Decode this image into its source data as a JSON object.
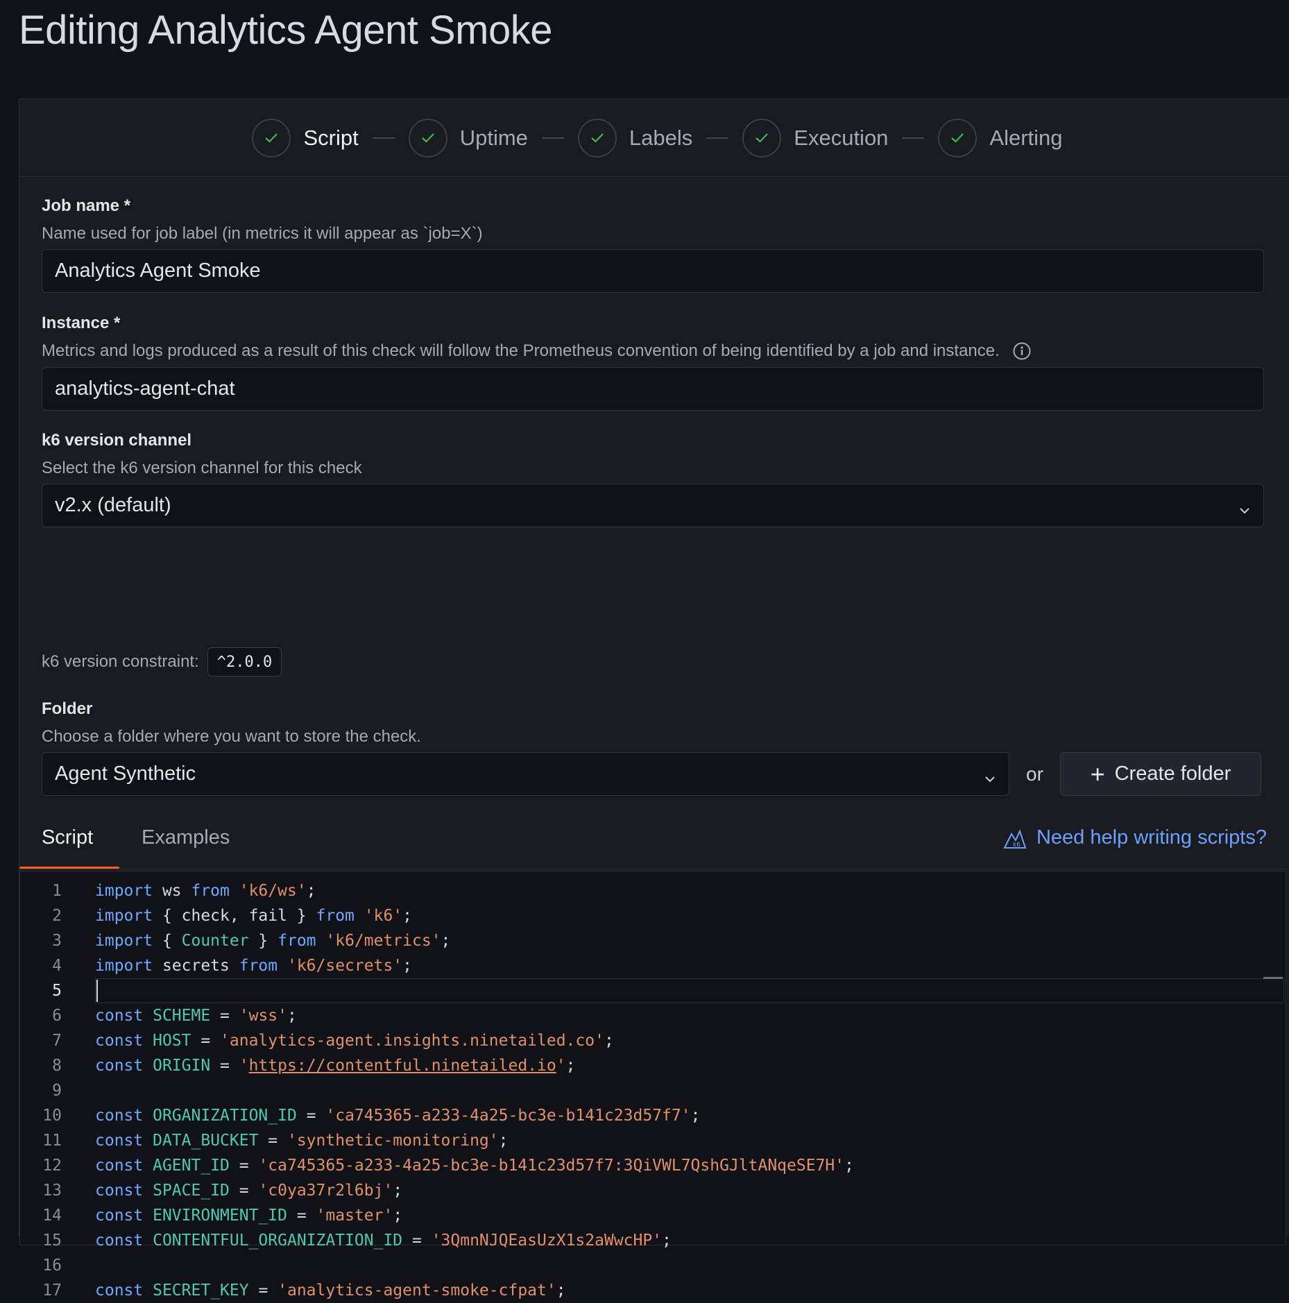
{
  "page": {
    "title": "Editing Analytics Agent Smoke"
  },
  "stepper": {
    "steps": [
      {
        "label": "Script",
        "state": "complete",
        "active": true
      },
      {
        "label": "Uptime",
        "state": "complete"
      },
      {
        "label": "Labels",
        "state": "complete"
      },
      {
        "label": "Execution",
        "state": "complete"
      },
      {
        "label": "Alerting",
        "state": "complete"
      }
    ]
  },
  "job_name": {
    "label": "Job name *",
    "description": "Name used for job label (in metrics it will appear as `job=X`)",
    "value": "Analytics Agent Smoke"
  },
  "instance": {
    "label": "Instance *",
    "description": "Metrics and logs produced as a result of this check will follow the Prometheus convention of being identified by a job and instance.",
    "value": "analytics-agent-chat"
  },
  "k6_channel": {
    "label": "k6 version channel",
    "description": "Select the k6 version channel for this check",
    "value": "v2.x (default)"
  },
  "k6_constraint": {
    "label": "k6 version constraint:",
    "value": "^2.0.0"
  },
  "folder": {
    "label": "Folder",
    "description": "Choose a folder where you want to store the check.",
    "value": "Agent Synthetic",
    "or_text": "or",
    "create_label": "Create folder"
  },
  "tabs": {
    "items": [
      {
        "label": "Script",
        "active": true
      },
      {
        "label": "Examples",
        "active": false
      }
    ],
    "help_link": "Need help writing scripts?"
  },
  "editor": {
    "current_line": 5,
    "lines": [
      {
        "n": "1",
        "tokens": [
          [
            "kw",
            "import"
          ],
          [
            "p",
            " ws "
          ],
          [
            "kw",
            "from"
          ],
          [
            "p",
            " "
          ],
          [
            "str",
            "'k6/ws'"
          ],
          [
            "p",
            ";"
          ]
        ]
      },
      {
        "n": "2",
        "tokens": [
          [
            "kw",
            "import"
          ],
          [
            "p",
            " { check, fail } "
          ],
          [
            "kw",
            "from"
          ],
          [
            "p",
            " "
          ],
          [
            "str",
            "'k6'"
          ],
          [
            "p",
            ";"
          ]
        ]
      },
      {
        "n": "3",
        "tokens": [
          [
            "kw",
            "import"
          ],
          [
            "p",
            " { "
          ],
          [
            "cst",
            "Counter"
          ],
          [
            "p",
            " } "
          ],
          [
            "kw",
            "from"
          ],
          [
            "p",
            " "
          ],
          [
            "str",
            "'k6/metrics'"
          ],
          [
            "p",
            ";"
          ]
        ]
      },
      {
        "n": "4",
        "tokens": [
          [
            "kw",
            "import"
          ],
          [
            "p",
            " secrets "
          ],
          [
            "kw",
            "from"
          ],
          [
            "p",
            " "
          ],
          [
            "str",
            "'k6/secrets'"
          ],
          [
            "p",
            ";"
          ]
        ]
      },
      {
        "n": "5",
        "tokens": []
      },
      {
        "n": "6",
        "tokens": [
          [
            "kw",
            "const"
          ],
          [
            "p",
            " "
          ],
          [
            "cst",
            "SCHEME"
          ],
          [
            "p",
            " = "
          ],
          [
            "str",
            "'wss'"
          ],
          [
            "p",
            ";"
          ]
        ]
      },
      {
        "n": "7",
        "tokens": [
          [
            "kw",
            "const"
          ],
          [
            "p",
            " "
          ],
          [
            "cst",
            "HOST"
          ],
          [
            "p",
            " = "
          ],
          [
            "str",
            "'analytics-agent.insights.ninetailed.co'"
          ],
          [
            "p",
            ";"
          ]
        ]
      },
      {
        "n": "8",
        "tokens": [
          [
            "kw",
            "const"
          ],
          [
            "p",
            " "
          ],
          [
            "cst",
            "ORIGIN"
          ],
          [
            "p",
            " = "
          ],
          [
            "str",
            "'"
          ],
          [
            "url",
            "https://contentful.ninetailed.io"
          ],
          [
            "str",
            "'"
          ],
          [
            "p",
            ";"
          ]
        ]
      },
      {
        "n": "9",
        "tokens": []
      },
      {
        "n": "10",
        "tokens": [
          [
            "kw",
            "const"
          ],
          [
            "p",
            " "
          ],
          [
            "cst",
            "ORGANIZATION_ID"
          ],
          [
            "p",
            " = "
          ],
          [
            "str",
            "'ca745365-a233-4a25-bc3e-b141c23d57f7'"
          ],
          [
            "p",
            ";"
          ]
        ]
      },
      {
        "n": "11",
        "tokens": [
          [
            "kw",
            "const"
          ],
          [
            "p",
            " "
          ],
          [
            "cst",
            "DATA_BUCKET"
          ],
          [
            "p",
            " = "
          ],
          [
            "str",
            "'synthetic-monitoring'"
          ],
          [
            "p",
            ";"
          ]
        ]
      },
      {
        "n": "12",
        "tokens": [
          [
            "kw",
            "const"
          ],
          [
            "p",
            " "
          ],
          [
            "cst",
            "AGENT_ID"
          ],
          [
            "p",
            " = "
          ],
          [
            "str",
            "'ca745365-a233-4a25-bc3e-b141c23d57f7:3QiVWL7QshGJltANqeSE7H'"
          ],
          [
            "p",
            ";"
          ]
        ]
      },
      {
        "n": "13",
        "tokens": [
          [
            "kw",
            "const"
          ],
          [
            "p",
            " "
          ],
          [
            "cst",
            "SPACE_ID"
          ],
          [
            "p",
            " = "
          ],
          [
            "str",
            "'c0ya37r2l6bj'"
          ],
          [
            "p",
            ";"
          ]
        ]
      },
      {
        "n": "14",
        "tokens": [
          [
            "kw",
            "const"
          ],
          [
            "p",
            " "
          ],
          [
            "cst",
            "ENVIRONMENT_ID"
          ],
          [
            "p",
            " = "
          ],
          [
            "str",
            "'master'"
          ],
          [
            "p",
            ";"
          ]
        ]
      },
      {
        "n": "15",
        "tokens": [
          [
            "kw",
            "const"
          ],
          [
            "p",
            " "
          ],
          [
            "cst",
            "CONTENTFUL_ORGANIZATION_ID"
          ],
          [
            "p",
            " = "
          ],
          [
            "str",
            "'3QmnNJQEasUzX1s2aWwcHP'"
          ],
          [
            "p",
            ";"
          ]
        ]
      },
      {
        "n": "16",
        "tokens": []
      },
      {
        "n": "17",
        "tokens": [
          [
            "kw",
            "const"
          ],
          [
            "p",
            " "
          ],
          [
            "cst",
            "SECRET_KEY"
          ],
          [
            "p",
            " = "
          ],
          [
            "str",
            "'analytics-agent-smoke-cfpat'"
          ],
          [
            "p",
            ";"
          ]
        ]
      }
    ]
  },
  "colors": {
    "accent": "#ff5a1f",
    "link": "#6e9fff",
    "success": "#3fb950"
  }
}
